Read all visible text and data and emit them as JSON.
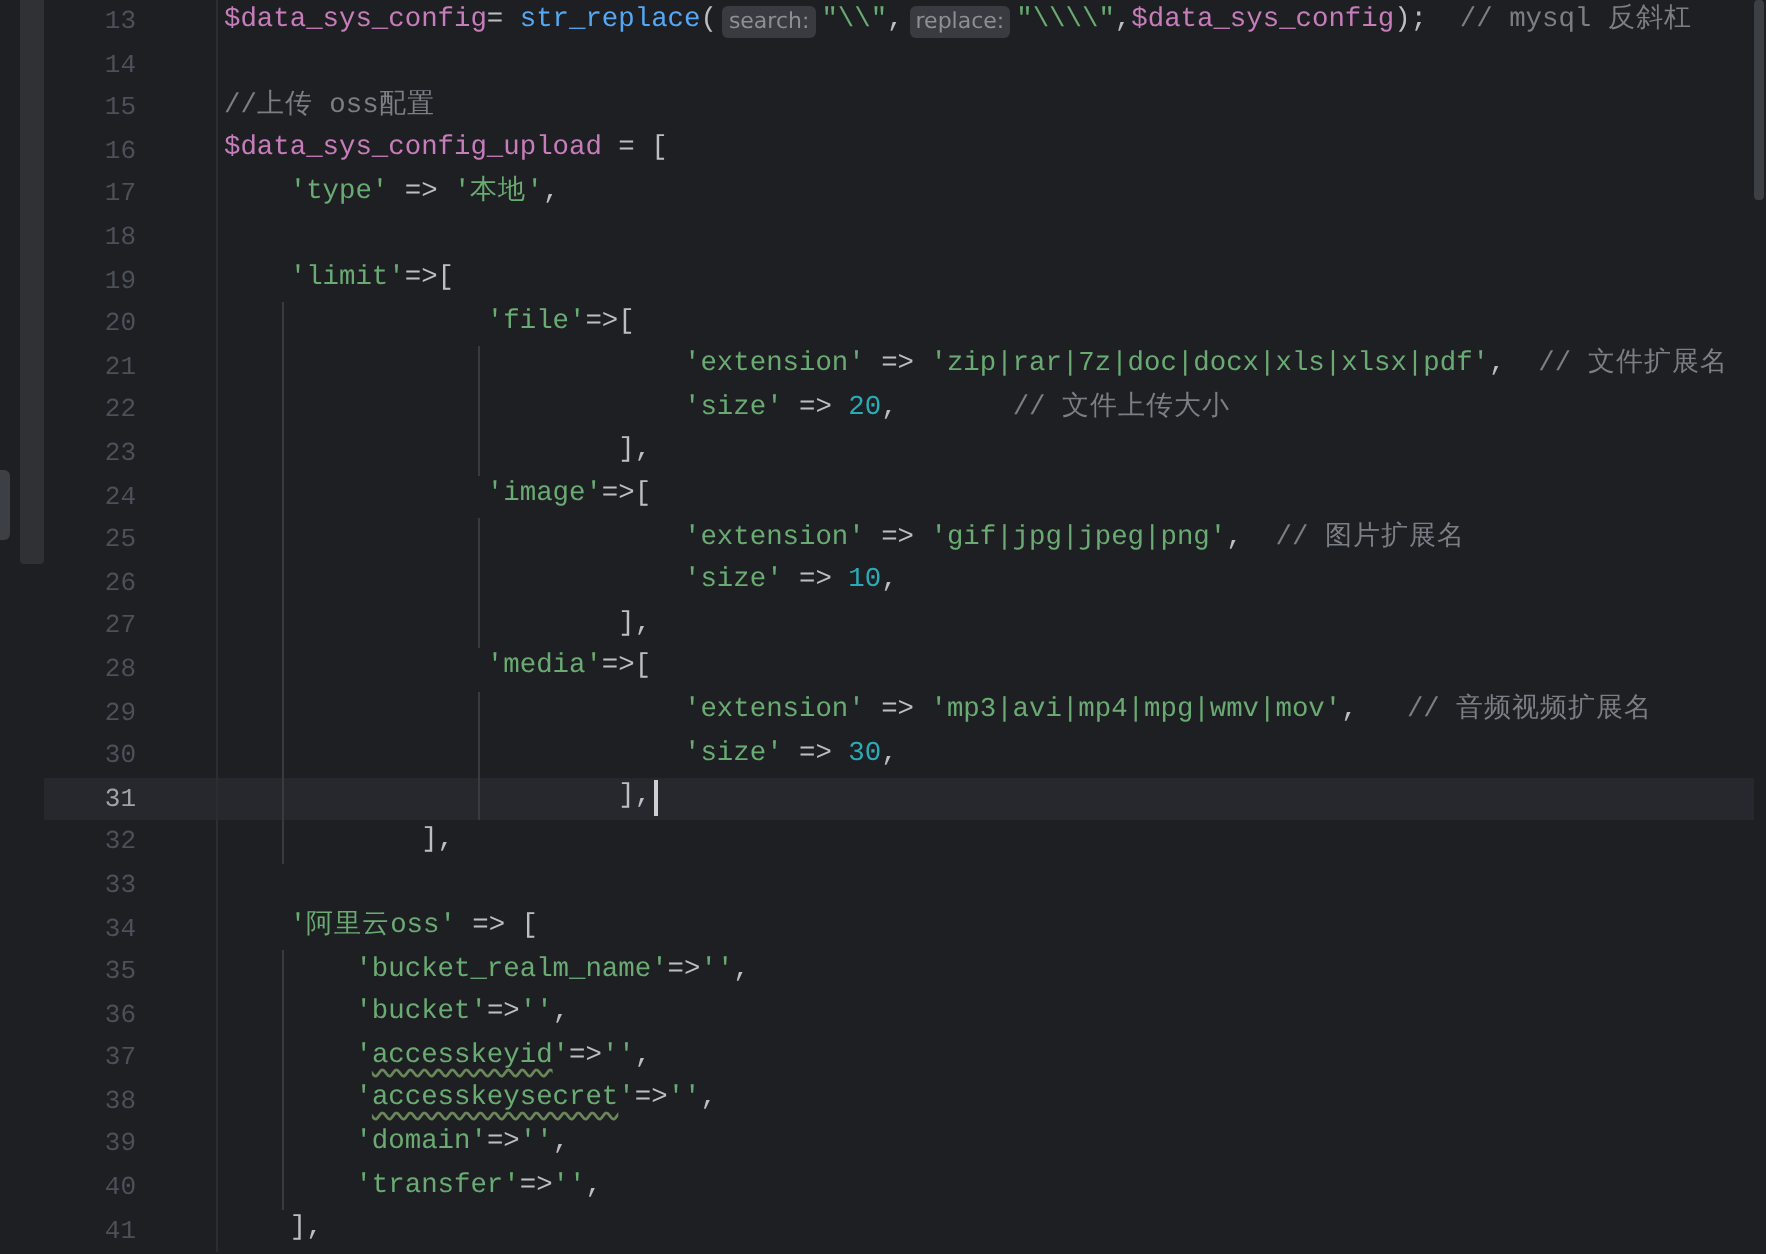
{
  "editor": {
    "lines": [
      {
        "number": "13",
        "current": false,
        "tokens": [
          {
            "kind": "var",
            "text": "$data_sys_config"
          },
          {
            "kind": "plain",
            "text": "= "
          },
          {
            "kind": "func",
            "text": "str_replace"
          },
          {
            "kind": "plain",
            "text": "("
          },
          {
            "kind": "hint",
            "text": "search:"
          },
          {
            "kind": "str",
            "text": "\"\\\\\""
          },
          {
            "kind": "plain",
            "text": ","
          },
          {
            "kind": "hint",
            "text": "replace:"
          },
          {
            "kind": "str",
            "text": "\"\\\\\\\\\""
          },
          {
            "kind": "plain",
            "text": ","
          },
          {
            "kind": "var",
            "text": "$data_sys_config"
          },
          {
            "kind": "plain",
            "text": ");  "
          },
          {
            "kind": "comment",
            "text": "// mysql 反斜杠"
          }
        ]
      },
      {
        "number": "14",
        "current": false
      },
      {
        "number": "15",
        "current": false,
        "tokens": [
          {
            "kind": "comment",
            "text": "//上传 oss配置"
          }
        ]
      },
      {
        "number": "16",
        "current": false,
        "tokens": [
          {
            "kind": "var",
            "text": "$data_sys_config_upload"
          },
          {
            "kind": "plain",
            "text": " = ["
          }
        ]
      },
      {
        "number": "17",
        "current": false,
        "tokens": [
          {
            "kind": "str",
            "text": "    'type'"
          },
          {
            "kind": "plain",
            "text": " => "
          },
          {
            "kind": "str",
            "text": "'本地'"
          },
          {
            "kind": "plain",
            "text": ","
          }
        ]
      },
      {
        "number": "18",
        "current": false
      },
      {
        "number": "19",
        "current": false,
        "tokens": [
          {
            "kind": "str",
            "text": "    'limit'"
          },
          {
            "kind": "plain",
            "text": "=>["
          }
        ]
      },
      {
        "number": "20",
        "current": false,
        "tokens": [
          {
            "kind": "str",
            "text": "                'file'"
          },
          {
            "kind": "plain",
            "text": "=>["
          }
        ]
      },
      {
        "number": "21",
        "current": false,
        "tokens": [
          {
            "kind": "str",
            "text": "                            'extension'"
          },
          {
            "kind": "plain",
            "text": " => "
          },
          {
            "kind": "str",
            "text": "'zip|rar|7z|doc|docx|xls|xlsx|pdf'"
          },
          {
            "kind": "plain",
            "text": ",  "
          },
          {
            "kind": "comment",
            "text": "// 文件扩展名"
          }
        ]
      },
      {
        "number": "22",
        "current": false,
        "tokens": [
          {
            "kind": "str",
            "text": "                            'size'"
          },
          {
            "kind": "plain",
            "text": " => "
          },
          {
            "kind": "num",
            "text": "20"
          },
          {
            "kind": "plain",
            "text": ",       "
          },
          {
            "kind": "comment",
            "text": "// 文件上传大小"
          }
        ]
      },
      {
        "number": "23",
        "current": false,
        "tokens": [
          {
            "kind": "plain",
            "text": "                        ],"
          }
        ]
      },
      {
        "number": "24",
        "current": false,
        "tokens": [
          {
            "kind": "str",
            "text": "                'image'"
          },
          {
            "kind": "plain",
            "text": "=>["
          }
        ]
      },
      {
        "number": "25",
        "current": false,
        "tokens": [
          {
            "kind": "str",
            "text": "                            'extension'"
          },
          {
            "kind": "plain",
            "text": " => "
          },
          {
            "kind": "str",
            "text": "'gif|jpg|jpeg|png'"
          },
          {
            "kind": "plain",
            "text": ",  "
          },
          {
            "kind": "comment",
            "text": "// 图片扩展名"
          }
        ]
      },
      {
        "number": "26",
        "current": false,
        "tokens": [
          {
            "kind": "str",
            "text": "                            'size'"
          },
          {
            "kind": "plain",
            "text": " => "
          },
          {
            "kind": "num",
            "text": "10"
          },
          {
            "kind": "plain",
            "text": ","
          }
        ]
      },
      {
        "number": "27",
        "current": false,
        "tokens": [
          {
            "kind": "plain",
            "text": "                        ],"
          }
        ]
      },
      {
        "number": "28",
        "current": false,
        "tokens": [
          {
            "kind": "str",
            "text": "                'media'"
          },
          {
            "kind": "plain",
            "text": "=>["
          }
        ]
      },
      {
        "number": "29",
        "current": false,
        "tokens": [
          {
            "kind": "str",
            "text": "                            'extension'"
          },
          {
            "kind": "plain",
            "text": " => "
          },
          {
            "kind": "str",
            "text": "'mp3|avi|mp4|mpg|wmv|mov'"
          },
          {
            "kind": "plain",
            "text": ",   "
          },
          {
            "kind": "comment",
            "text": "// 音频视频扩展名"
          }
        ]
      },
      {
        "number": "30",
        "current": false,
        "tokens": [
          {
            "kind": "str",
            "text": "                            'size'"
          },
          {
            "kind": "plain",
            "text": " => "
          },
          {
            "kind": "num",
            "text": "30"
          },
          {
            "kind": "plain",
            "text": ","
          }
        ]
      },
      {
        "number": "31",
        "current": true,
        "tokens": [
          {
            "kind": "plain",
            "text": "                        ],"
          }
        ]
      },
      {
        "number": "32",
        "current": false,
        "tokens": [
          {
            "kind": "plain",
            "text": "            ],"
          }
        ]
      },
      {
        "number": "33",
        "current": false
      },
      {
        "number": "34",
        "current": false,
        "tokens": [
          {
            "kind": "str",
            "text": "    '阿里云oss'"
          },
          {
            "kind": "plain",
            "text": " => ["
          }
        ]
      },
      {
        "number": "35",
        "current": false,
        "tokens": [
          {
            "kind": "str",
            "text": "        'bucket_realm_name'"
          },
          {
            "kind": "plain",
            "text": "=>"
          },
          {
            "kind": "str",
            "text": "''"
          },
          {
            "kind": "plain",
            "text": ","
          }
        ]
      },
      {
        "number": "36",
        "current": false,
        "tokens": [
          {
            "kind": "str",
            "text": "        'bucket'"
          },
          {
            "kind": "plain",
            "text": "=>"
          },
          {
            "kind": "str",
            "text": "''"
          },
          {
            "kind": "plain",
            "text": ","
          }
        ]
      },
      {
        "number": "37",
        "current": false,
        "tokens": [
          {
            "kind": "str",
            "text": "        '"
          },
          {
            "kind": "typo",
            "text": "accesskeyid"
          },
          {
            "kind": "str",
            "text": "'"
          },
          {
            "kind": "plain",
            "text": "=>"
          },
          {
            "kind": "str",
            "text": "''"
          },
          {
            "kind": "plain",
            "text": ","
          }
        ]
      },
      {
        "number": "38",
        "current": false,
        "tokens": [
          {
            "kind": "str",
            "text": "        '"
          },
          {
            "kind": "typo",
            "text": "accesskeysecret"
          },
          {
            "kind": "str",
            "text": "'"
          },
          {
            "kind": "plain",
            "text": "=>"
          },
          {
            "kind": "str",
            "text": "''"
          },
          {
            "kind": "plain",
            "text": ","
          }
        ]
      },
      {
        "number": "39",
        "current": false,
        "tokens": [
          {
            "kind": "str",
            "text": "        'domain'"
          },
          {
            "kind": "plain",
            "text": "=>"
          },
          {
            "kind": "str",
            "text": "''"
          },
          {
            "kind": "plain",
            "text": ","
          }
        ]
      },
      {
        "number": "40",
        "current": false,
        "tokens": [
          {
            "kind": "str",
            "text": "        'transfer'"
          },
          {
            "kind": "plain",
            "text": "=>"
          },
          {
            "kind": "str",
            "text": "''"
          },
          {
            "kind": "plain",
            "text": ","
          }
        ]
      },
      {
        "number": "41",
        "current": false,
        "tokens": [
          {
            "kind": "plain",
            "text": "    ],"
          }
        ]
      }
    ]
  }
}
